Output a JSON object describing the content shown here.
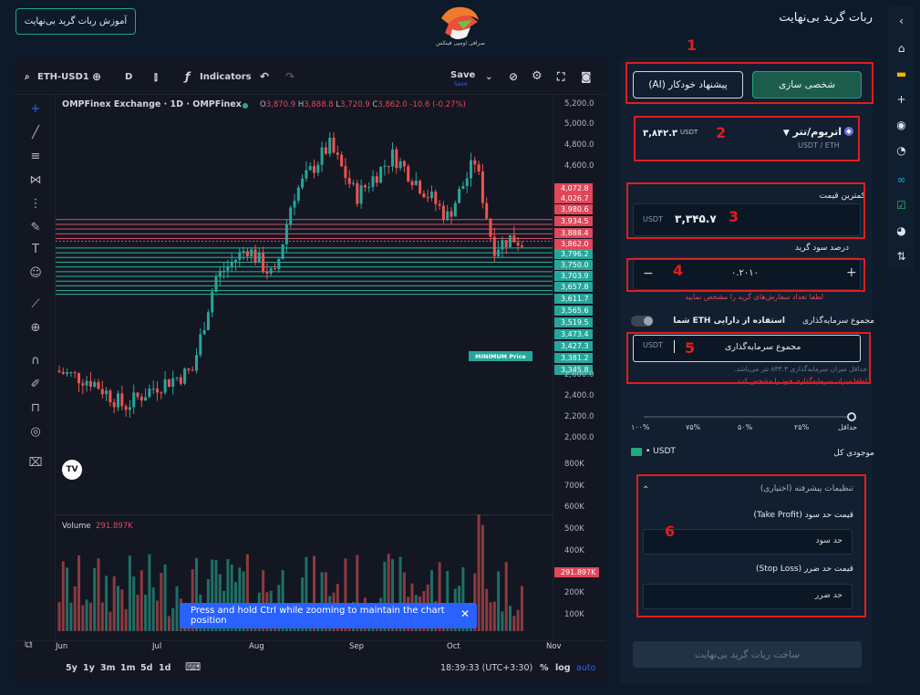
{
  "header": {
    "tutorial_button": "آموزش ربات گرید بی‌نهایت",
    "logo_caption": "صرافی اومپی فینکس",
    "page_title": "ربات گرید بی‌نهایت"
  },
  "chart": {
    "symbol": "ETH-USD1",
    "interval": "D",
    "indicators_label": "Indicators",
    "save_label": "Save",
    "save_sub": "Save",
    "title_line": "OMPFinex Exchange · 1D · OMPFinex",
    "ohlc": {
      "o": "3,870.9",
      "h": "3,888.8",
      "l": "3,720.9",
      "c": "3,862.0",
      "chg": "-10.6 (-0.27%)"
    },
    "price_ticks": [
      "5,200.0",
      "5,000.0",
      "4,800.0",
      "4,600.0",
      "2,600.0",
      "2,400.0",
      "2,200.0",
      "2,000.0"
    ],
    "grid_tags_red": [
      "4,072.8",
      "4,026.7",
      "3,980.6",
      "3,934.5",
      "3,888.4",
      "3,862.0"
    ],
    "grid_tags_green": [
      "3,796.2",
      "3,750.0",
      "3,703.9",
      "3,657.8",
      "3,611.7",
      "3,565.6",
      "3,519.5",
      "3,473.4",
      "3,427.3",
      "3,381.2",
      "3,345.8"
    ],
    "minimum_label": "MINIMUM  Price",
    "volume_label": "Volume",
    "volume_value": "291.897K",
    "volume_ticks": [
      "800K",
      "700K",
      "600K",
      "500K",
      "400K",
      "200K",
      "100K"
    ],
    "volume_tag": "291.897K",
    "x_ticks": [
      "Jun",
      "Jul",
      "Aug",
      "Sep",
      "Oct",
      "Nov"
    ],
    "timeframes": [
      "5y",
      "1y",
      "3m",
      "1m",
      "5d",
      "1d"
    ],
    "clock": "18:39:33 (UTC+3:30)",
    "percent": "%",
    "log": "log",
    "auto": "auto",
    "tooltip": "Press and hold Ctrl while zooming to maintain the chart position",
    "tv_logo": "TV",
    "chart_data": {
      "type": "candlestick",
      "price_range": [
        2000,
        5200
      ],
      "volume_range": [
        0,
        800000
      ],
      "grid_levels_above": [
        4072.8,
        4026.7,
        3980.6,
        3934.5,
        3888.4
      ],
      "current_price": 3862.0,
      "grid_levels_below": [
        3796.2,
        3750.0,
        3703.9,
        3657.8,
        3611.7,
        3565.6,
        3519.5,
        3473.4,
        3427.3,
        3381.2,
        3345.8
      ]
    }
  },
  "form": {
    "mode_custom": "شخصی سازی",
    "mode_ai": "پیشنهاد خودکار (AI)",
    "pair_name": "اتریوم/تتر",
    "pair_sub": "USDT / ETH",
    "pair_price": "۳,۸۴۲.۳",
    "pair_unit": "USDT",
    "min_price_label": "کمترین قیمت",
    "min_price_value": "۳,۳۴۵.۷",
    "min_price_unit": "USDT",
    "profit_label": "درصد سود گرید",
    "profit_value": "۰.۲۰۱۰",
    "profit_hint": "لطفا تعداد سفارش‌های گرید را مشخص نمایید",
    "invest_label": "مجموع سرمایه‌گذاری",
    "eth_toggle_label": "استفاده از دارایی ETH شما",
    "invest_placeholder": "مجموع سرمایه‌گذاری",
    "invest_unit": "USDT",
    "invest_hint": "حداقل میزان سرمایه‌گذاری ۸۳۳.۳ تتر می‌باشد.",
    "invest_error": "لطفا میزان سرمایه‌گذاری خود را مشخص کنید",
    "slider_min": "حداقل",
    "slider_marks": [
      "۲۵%",
      "۵۰%",
      "۷۵%",
      "۱۰۰%"
    ],
    "balance_label": "موجودی کل",
    "balance_value": "USDT",
    "adv_title": "تنظیمات پیشرفته (اختیاری)",
    "tp_label": "قیمت حد سود (Take Profit)",
    "tp_placeholder": "حد سود",
    "sl_label": "قیمت حد ضرر (Stop Loss)",
    "sl_placeholder": "حد ضرر",
    "submit": "ساخت ربات گرید بی‌نهایت"
  },
  "annotations": [
    "1",
    "2",
    "3",
    "4",
    "5",
    "6"
  ],
  "colors": {
    "accent": "#1fa97f",
    "red": "#e11d1d",
    "down": "#e0475a",
    "up": "#26a69a",
    "bg": "#0c1a29"
  }
}
